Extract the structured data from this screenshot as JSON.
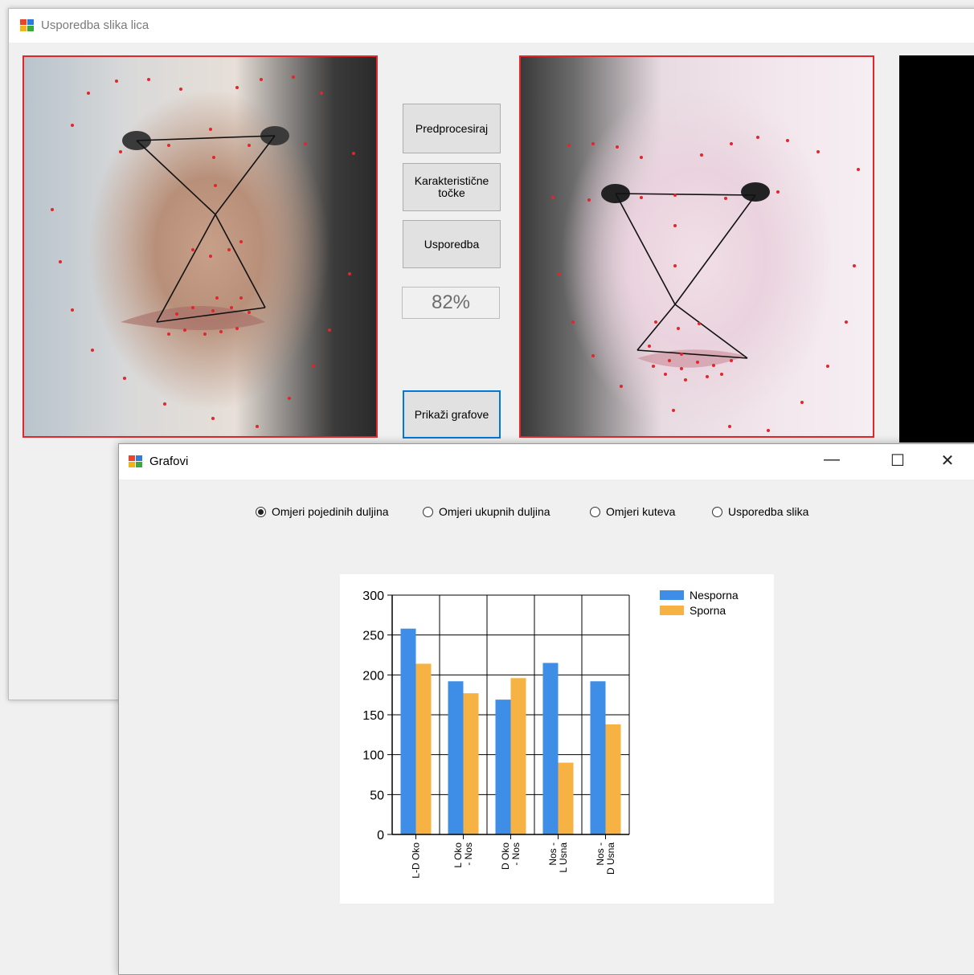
{
  "main_window": {
    "title": "Usporedba slika lica",
    "buttons": {
      "preprocess": "Predprocesiraj",
      "landmarks_line1": "Karakteristične",
      "landmarks_line2": "točke",
      "compare": "Usporedba",
      "show_charts": "Prikaži grafove"
    },
    "score": "82%"
  },
  "charts_window": {
    "title": "Grafovi",
    "controls": {
      "minimize": "—",
      "maximize": "☐",
      "close": "✕"
    },
    "radios": [
      {
        "label": "Omjeri pojedinih duljina",
        "checked": true
      },
      {
        "label": "Omjeri ukupnih duljina",
        "checked": false
      },
      {
        "label": "Omjeri kuteva",
        "checked": false
      },
      {
        "label": "Usporedba slika",
        "checked": false
      }
    ]
  },
  "chart_data": {
    "type": "bar",
    "categories": [
      [
        "L-D Oko"
      ],
      [
        "L Oko",
        "- Nos"
      ],
      [
        "D Oko",
        "- Nos"
      ],
      [
        "Nos -",
        "L Usna"
      ],
      [
        "Nos -",
        "D Usna"
      ]
    ],
    "series": [
      {
        "name": "Nesporna",
        "color": "#3e8ee8",
        "values": [
          258,
          192,
          169,
          215,
          192
        ]
      },
      {
        "name": "Sporna",
        "color": "#f7b244",
        "values": [
          214,
          177,
          196,
          90,
          138
        ]
      }
    ],
    "ylim": [
      0,
      300
    ],
    "yticks": [
      0,
      50,
      100,
      150,
      200,
      250,
      300
    ],
    "grid": true,
    "legend": "right"
  }
}
